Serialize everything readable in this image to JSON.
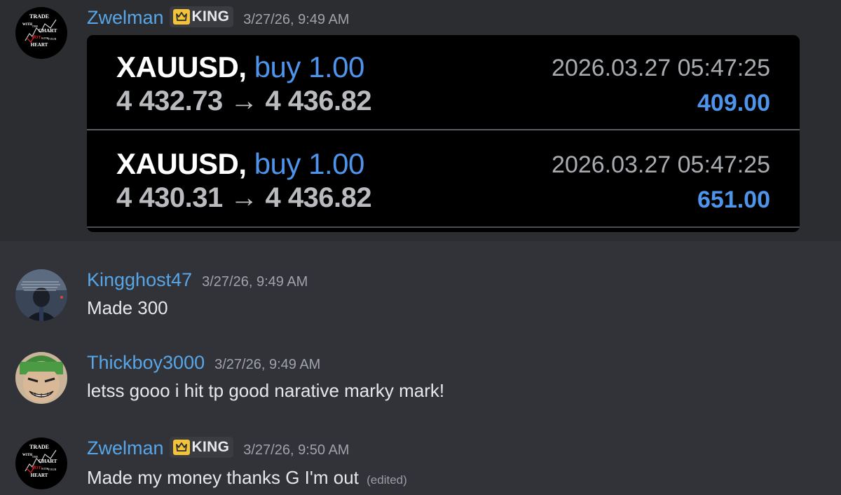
{
  "messages": [
    {
      "username": "Zwelman",
      "role": "KING",
      "timestamp": "3/27/26, 9:49 AM",
      "avatar_text": [
        "TRADE",
        "WITH",
        "THE",
        "CHART",
        "NOT",
        "WITH",
        "YOUR",
        "HEART"
      ],
      "trades": [
        {
          "symbol": "XAUUSD,",
          "side": "buy 1.00",
          "open_price": "4 432.73",
          "arrow": "→",
          "close_price": "4 436.82",
          "time": "2026.03.27 05:47:25",
          "profit": "409.00"
        },
        {
          "symbol": "XAUUSD,",
          "side": "buy 1.00",
          "open_price": "4 430.31",
          "arrow": "→",
          "close_price": "4 436.82",
          "time": "2026.03.27 05:47:25",
          "profit": "651.00"
        }
      ]
    },
    {
      "username": "Kingghost47",
      "timestamp": "3/27/26, 9:49 AM",
      "text": "Made 300"
    },
    {
      "username": "Thickboy3000",
      "timestamp": "3/27/26, 9:49 AM",
      "text": "letss gooo i hit tp good narative marky mark!"
    },
    {
      "username": "Zwelman",
      "role": "KING",
      "timestamp": "3/27/26, 9:50 AM",
      "text": "Made my money thanks G I'm out",
      "edited": "(edited)"
    }
  ],
  "colors": {
    "background": "#313338",
    "highlight": "#2b2d31",
    "username": "#58a6e7",
    "buy": "#4d94ea",
    "role_icon": "#f3c338"
  },
  "icons": {
    "role": "crown-icon"
  }
}
